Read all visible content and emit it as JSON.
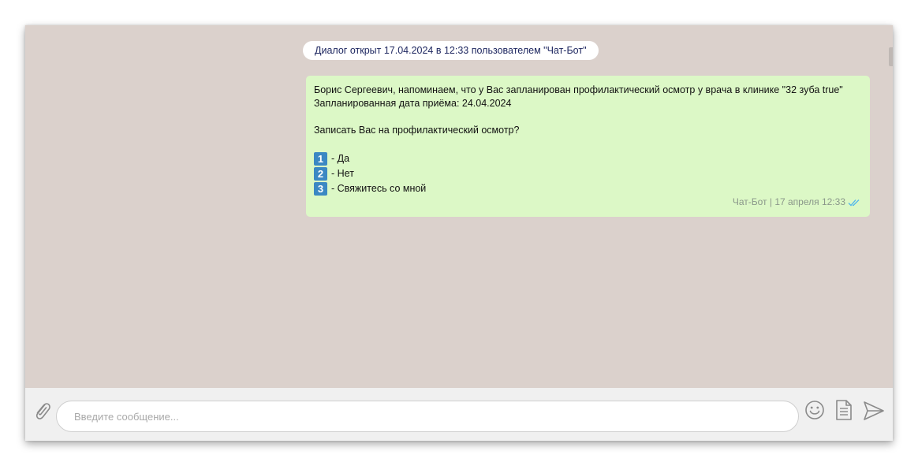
{
  "system": {
    "dialog_opened": "Диалог открыт 17.04.2024 в 12:33 пользователем \"Чат-Бот\""
  },
  "message": {
    "line1": "Борис Сергеевич, напоминаем, что у Вас запланирован профилактический осмотр у врача в клинике \"32 зуба true\"",
    "line2": "Запланированная дата приёма: 24.04.2024",
    "question": "Записать Вас на профилактический осмотр?",
    "options": [
      {
        "number": "1",
        "label": "- Да"
      },
      {
        "number": "2",
        "label": "- Нет"
      },
      {
        "number": "3",
        "label": "- Свяжитесь со мной"
      }
    ],
    "meta": "Чат-Бот | 17 апреля 12:33",
    "status_icon": "double-check-icon"
  },
  "composer": {
    "placeholder": "Введите сообщение...",
    "value": ""
  },
  "icons": {
    "attach": "paperclip-icon",
    "emoji": "smiley-icon",
    "template": "document-icon",
    "send": "send-icon"
  },
  "colors": {
    "chat_background": "#dbd1cc",
    "bubble": "#dcf8c6",
    "option_badge": "#3b88c3",
    "read_ticks": "#4fb6ec",
    "input_bar": "#f0f0f0"
  }
}
